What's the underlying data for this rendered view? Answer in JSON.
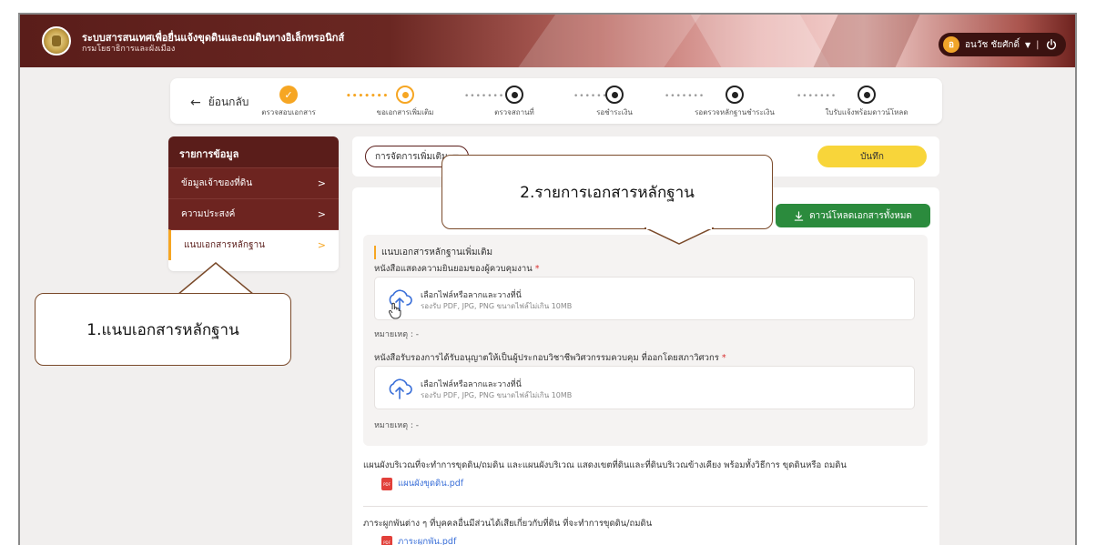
{
  "header": {
    "system_title": "ระบบสารสนเทศเพื่อยื่นแจ้งขุดดินและถมดินทางอิเล็กทรอนิกส์",
    "department": "กรมโยธาธิการและผังเมือง",
    "user": {
      "initial": "อ",
      "name": "อนวัช ชัยศักดิ์",
      "separator": "|"
    }
  },
  "stepper": {
    "back_label": "ย้อนกลับ",
    "steps": [
      {
        "label": "ตรวจสอบเอกสาร",
        "state": "done"
      },
      {
        "label": "ขอเอกสารเพิ่มเติม",
        "state": "current"
      },
      {
        "label": "ตรวจสถานที่",
        "state": "todo"
      },
      {
        "label": "รอชำระเงิน",
        "state": "todo"
      },
      {
        "label": "รอตรวจหลักฐานชำระเงิน",
        "state": "todo"
      },
      {
        "label": "ใบรับแจ้งพร้อมดาวน์โหลด",
        "state": "todo"
      }
    ]
  },
  "sidebar": {
    "title": "รายการข้อมูล",
    "items": [
      {
        "label": "ข้อมูลเจ้าของที่ดิน"
      },
      {
        "label": "ความประสงค์"
      },
      {
        "label": "แนบเอกสารหลักฐาน"
      }
    ]
  },
  "actions": {
    "manage_label": "การจัดการเพิ่มเติม",
    "save_label": "บันทึก"
  },
  "main": {
    "download_all_label": "ดาวน์โหลดเอกสารทั้งหมด",
    "extra_title": "แนบเอกสารหลักฐานเพิ่มเติม",
    "upload_text": "เลือกไฟล์หรือลากและวางที่นี่",
    "upload_hint": "รองรับ PDF, JPG, PNG ขนาดไฟล์ไม่เกิน 10MB",
    "note_text": "หมายเหตุ : -",
    "fields": [
      {
        "label": "หนังสือแสดงความยินยอมของผู้ควบคุมงาน",
        "required": "*"
      },
      {
        "label": "หนังสือรับรองการได้รับอนุญาตให้เป็นผู้ประกอบวิชาชีพวิศวกรรมควบคุม ที่ออกโดยสภาวิศวกร",
        "required": "*"
      }
    ],
    "documents": [
      {
        "label": "แผนผังบริเวณที่จะทำการขุดดิน/ถมดิน และแผนผังบริเวณ แสดงเขตที่ดินและที่ดินบริเวณข้างเคียง พร้อมทั้งวิธีการ ขุดดินหรือ ถมดิน",
        "file": "แผนผังขุดดิน.pdf"
      },
      {
        "label": "ภาระผูกพันต่าง ๆ ที่บุคคลอื่นมีส่วนได้เสียเกี่ยวกับที่ดิน ที่จะทำการขุดดิน/ถมดิน",
        "file": "ภาระผูกพัน.pdf"
      }
    ]
  },
  "callouts": {
    "one": "1.แนบเอกสารหลักฐาน",
    "two": "2.รายการเอกสารหลักฐาน"
  },
  "colors": {
    "brand": "#5a1d1a",
    "accent": "#f6a623",
    "save": "#f8d53a",
    "download": "#2b8b3d"
  }
}
